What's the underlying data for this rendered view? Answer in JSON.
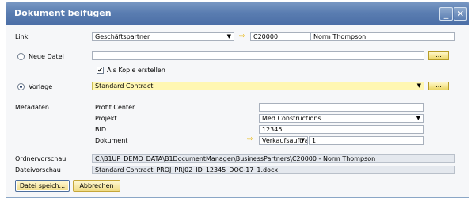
{
  "window": {
    "title": "Dokument beifügen",
    "minimize_glyph": "_",
    "close_glyph": "✕"
  },
  "link": {
    "label": "Link",
    "type_value": "Geschäftspartner",
    "code_value": "C20000",
    "name_value": "Norm Thompson"
  },
  "new_file": {
    "label": "Neue Datei",
    "path_value": "",
    "browse_label": "...",
    "copy_checkbox_label": "Als Kopie erstellen",
    "copy_checked": true,
    "copy_check_glyph": "✔"
  },
  "template": {
    "label": "Vorlage",
    "value": "Standard Contract",
    "browse_label": "..."
  },
  "metadata": {
    "label": "Metadaten",
    "fields": [
      {
        "label": "Profit Center",
        "value": ""
      },
      {
        "label": "Projekt",
        "value": "Med Constructions"
      },
      {
        "label": "BID",
        "value": "12345"
      },
      {
        "label": "Dokument",
        "value": "Verkaufsauftrag",
        "number": "1"
      }
    ]
  },
  "folder_preview": {
    "label": "Ordnervorschau",
    "value": "C:\\B1UP_DEMO_DATA\\B1DocumentManager\\BusinessPartners\\C20000 - Norm Thompson"
  },
  "file_preview": {
    "label": "Dateivorschau",
    "value": "Standard Contract_PROJ_PRJ02_ID_12345_DOC-17_1.docx"
  },
  "buttons": {
    "save": "Datei speich...",
    "cancel": "Abbrechen"
  },
  "icons": {
    "dropdown": "▼",
    "link_arrow": "⇨"
  }
}
